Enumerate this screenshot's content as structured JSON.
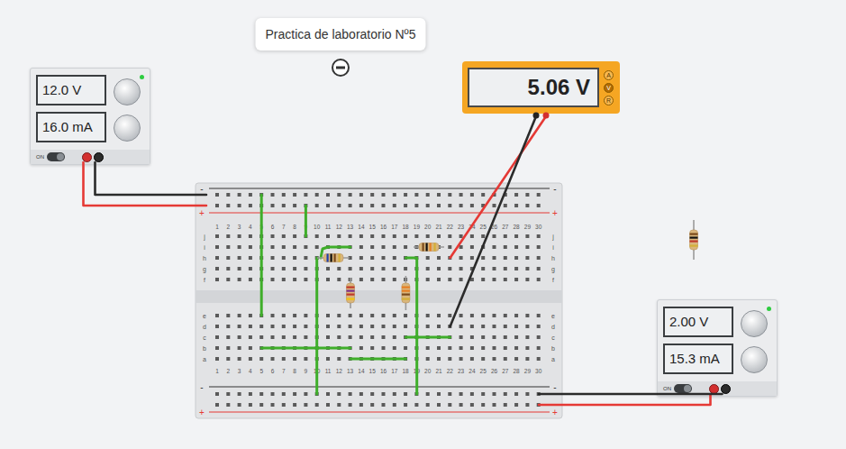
{
  "tooltip": {
    "text": "Practica de laboratorio Nº5"
  },
  "power_supplies": [
    {
      "voltage": "12.0 V",
      "current": "16.0 mA",
      "switch_label": "ON",
      "on": true
    },
    {
      "voltage": "2.00 V",
      "current": "15.3 mA",
      "switch_label": "ON",
      "on": true
    }
  ],
  "multimeter": {
    "reading": "5.06 V",
    "modes": [
      {
        "label": "A",
        "selected": false
      },
      {
        "label": "V",
        "selected": true
      },
      {
        "label": "R",
        "selected": false
      }
    ]
  },
  "breadboard": {
    "columns": [
      "1",
      "2",
      "3",
      "4",
      "5",
      "6",
      "7",
      "8",
      "9",
      "10",
      "11",
      "12",
      "13",
      "14",
      "15",
      "16",
      "17",
      "18",
      "19",
      "20",
      "21",
      "22",
      "23",
      "24",
      "25",
      "26",
      "27",
      "28",
      "29",
      "30"
    ],
    "rows_top": [
      "j",
      "i",
      "h",
      "g",
      "f"
    ],
    "rows_bottom": [
      "e",
      "d",
      "c",
      "b",
      "a"
    ],
    "rail_minus": "-",
    "rail_plus": "+"
  },
  "resistors": [
    {
      "bands": [
        {
          "color": "#1e40af"
        },
        {
          "color": "#111111"
        },
        {
          "color": "#7a4a1c"
        },
        {
          "color": "#d4af37"
        }
      ]
    },
    {
      "bands": [
        {
          "color": "#c0392b"
        },
        {
          "color": "#7b2d8b"
        },
        {
          "color": "#c0392b"
        },
        {
          "color": "#f1c40f"
        }
      ]
    },
    {
      "bands": [
        {
          "color": "#e67e22"
        },
        {
          "color": "#e67e22"
        },
        {
          "color": "#7a4a1c"
        },
        {
          "color": "#d4af37"
        }
      ]
    },
    {
      "bands": [
        {
          "color": "#7a4a1c"
        },
        {
          "color": "#111111"
        },
        {
          "color": "#e67e22"
        },
        {
          "color": "#d4af37"
        }
      ]
    },
    {
      "bands": [
        {
          "color": "#7a4a1c"
        },
        {
          "color": "#111111"
        },
        {
          "color": "#c0392b"
        },
        {
          "color": "#d4af37"
        }
      ]
    }
  ]
}
